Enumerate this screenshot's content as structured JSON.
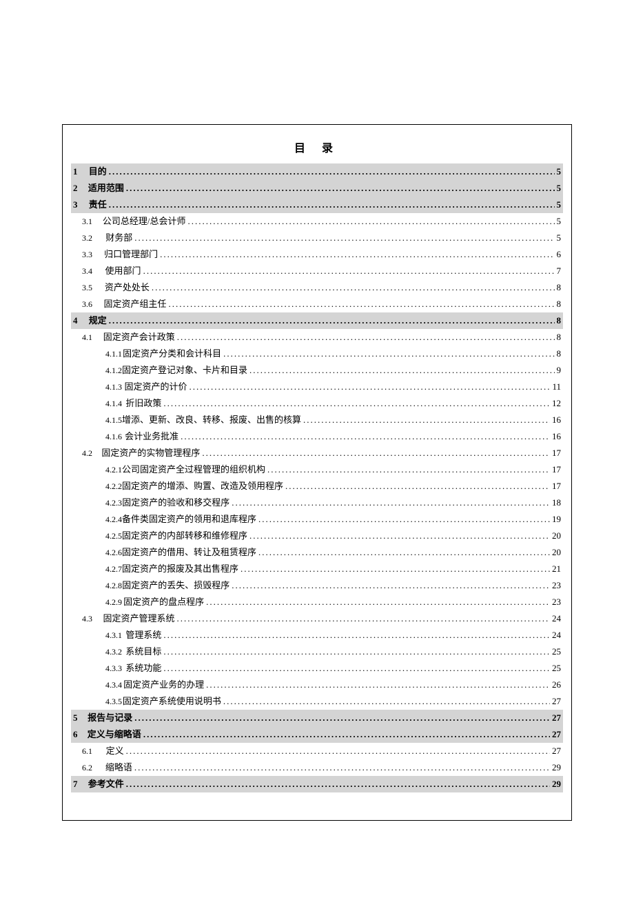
{
  "title": "目 录",
  "toc": [
    {
      "level": 1,
      "num": "1",
      "text": "目的",
      "page": "5",
      "shaded": true
    },
    {
      "level": 1,
      "num": "2",
      "text": "适用范围",
      "page": "5",
      "shaded": true
    },
    {
      "level": 1,
      "num": "3",
      "text": "责任",
      "page": "5",
      "shaded": true
    },
    {
      "level": 2,
      "num": "3.1",
      "text": "公司总经理/总会计师",
      "page": "5"
    },
    {
      "level": 2,
      "num": "3.2",
      "text": "财务部",
      "page": "5"
    },
    {
      "level": 2,
      "num": "3.3",
      "text": "归口管理部门",
      "page": "6"
    },
    {
      "level": 2,
      "num": "3.4",
      "text": "使用部门",
      "page": "7"
    },
    {
      "level": 2,
      "num": "3.5",
      "text": "资产处处长",
      "page": "8"
    },
    {
      "level": 2,
      "num": "3.6",
      "text": "固定资产组主任",
      "page": "8"
    },
    {
      "level": 1,
      "num": "4",
      "text": "规定",
      "page": "8",
      "shaded": true
    },
    {
      "level": 2,
      "num": "4.1",
      "text": "固定资产会计政策",
      "page": "8"
    },
    {
      "level": 3,
      "num": "4.1.1",
      "text": "固定资产分类和会计科目",
      "page": "8"
    },
    {
      "level": 3,
      "num": "4.1.2",
      "text": "固定资产登记对象、卡片和目录",
      "page": "9"
    },
    {
      "level": 3,
      "num": "4.1.3",
      "text": "固定资产的计价",
      "page": "11"
    },
    {
      "level": 3,
      "num": "4.1.4",
      "text": "折旧政策",
      "page": "12"
    },
    {
      "level": 3,
      "num": "4.1.5",
      "text": "增添、更新、改良、转移、报废、出售的核算",
      "page": "16"
    },
    {
      "level": 3,
      "num": "4.1.6",
      "text": "会计业务批准",
      "page": "16"
    },
    {
      "level": 2,
      "num": "4.2",
      "text": "固定资产的实物管理程序",
      "page": "17"
    },
    {
      "level": 3,
      "num": "4.2.1",
      "text": "公司固定资产全过程管理的组织机构",
      "page": "17"
    },
    {
      "level": 3,
      "num": "4.2.2",
      "text": "固定资产的增添、购置、改造及领用程序",
      "page": "17"
    },
    {
      "level": 3,
      "num": "4.2.3",
      "text": "固定资产的验收和移交程序",
      "page": "18"
    },
    {
      "level": 3,
      "num": "4.2.4",
      "text": "备件类固定资产的领用和退库程序",
      "page": "19"
    },
    {
      "level": 3,
      "num": "4.2.5",
      "text": "固定资产的内部转移和维修程序",
      "page": "20"
    },
    {
      "level": 3,
      "num": "4.2.6",
      "text": "固定资产的借用、转让及租赁程序",
      "page": "20"
    },
    {
      "level": 3,
      "num": "4.2.7",
      "text": "固定资产的报废及其出售程序",
      "page": "21"
    },
    {
      "level": 3,
      "num": "4.2.8",
      "text": "固定资产的丢失、损毁程序",
      "page": "23"
    },
    {
      "level": 3,
      "num": "4.2.9",
      "text": "固定资产的盘点程序",
      "page": "23"
    },
    {
      "level": 2,
      "num": "4.3",
      "text": "固定资产管理系统",
      "page": "24"
    },
    {
      "level": 3,
      "num": "4.3.1",
      "text": "管理系统",
      "page": "24"
    },
    {
      "level": 3,
      "num": "4.3.2",
      "text": "系统目标",
      "page": "25"
    },
    {
      "level": 3,
      "num": "4.3.3",
      "text": "系统功能",
      "page": "25"
    },
    {
      "level": 3,
      "num": "4.3.4",
      "text": "固定资产业务的办理",
      "page": "26"
    },
    {
      "level": 3,
      "num": "4.3.5",
      "text": "固定资产系统使用说明书",
      "page": "27"
    },
    {
      "level": 1,
      "num": "5",
      "text": "报告与记录",
      "page": "27",
      "shaded": true
    },
    {
      "level": 1,
      "num": "6",
      "text": "定义与缩略语",
      "page": "27",
      "shaded": true
    },
    {
      "level": 2,
      "num": "6.1",
      "text": "定义",
      "page": "27"
    },
    {
      "level": 2,
      "num": "6.2",
      "text": "缩略语",
      "page": "29"
    },
    {
      "level": 1,
      "num": "7",
      "text": "参考文件",
      "page": "29",
      "shaded": true
    }
  ]
}
